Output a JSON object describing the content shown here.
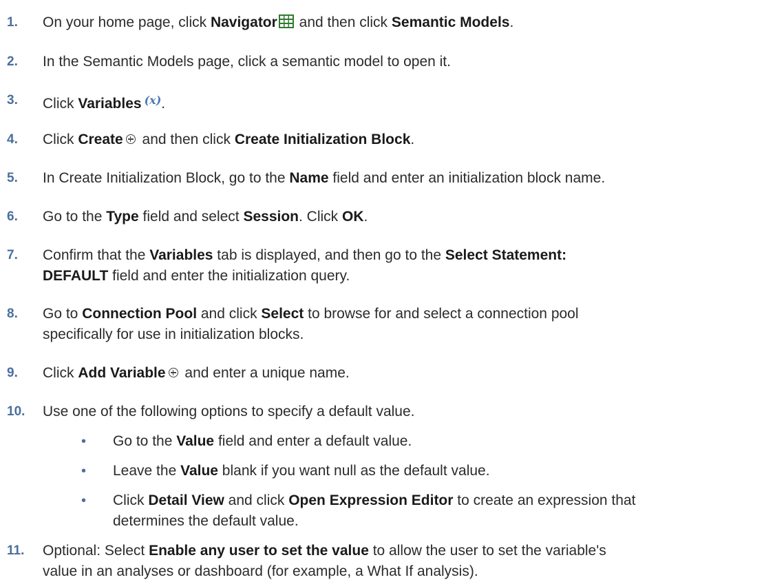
{
  "steps": [
    {
      "num": "1.",
      "parts": [
        "On your home page, click ",
        "Navigator",
        " and then click ",
        "Semantic Models",
        "."
      ]
    },
    {
      "num": "2.",
      "text": "In the Semantic Models page, click a semantic model to open it."
    },
    {
      "num": "3.",
      "parts": [
        "Click ",
        "Variables",
        "."
      ]
    },
    {
      "num": "4.",
      "parts": [
        "Click ",
        "Create",
        " and then click ",
        "Create Initialization Block",
        "."
      ]
    },
    {
      "num": "5.",
      "parts": [
        "In Create Initialization Block, go to the ",
        "Name",
        " field and enter an initialization block name."
      ]
    },
    {
      "num": "6.",
      "parts": [
        "Go to the ",
        "Type",
        " field and select ",
        "Session",
        ". Click ",
        "OK",
        "."
      ]
    },
    {
      "num": "7.",
      "parts": [
        "Confirm that the ",
        "Variables",
        " tab is displayed, and then go to the ",
        "Select Statement:",
        "DEFAULT",
        " field and enter the initialization query."
      ]
    },
    {
      "num": "8.",
      "parts": [
        "Go to ",
        "Connection Pool",
        " and click ",
        "Select",
        " to browse for and select a connection pool",
        "specifically for use in initialization blocks."
      ]
    },
    {
      "num": "9.",
      "parts": [
        "Click ",
        "Add Variable",
        " and enter a unique name."
      ]
    },
    {
      "num": "10.",
      "text": "Use one of the following options to specify a default value."
    },
    {
      "num": "11.",
      "parts": [
        "Optional: Select ",
        "Enable any user to set the value",
        " to allow the user to set the variable's",
        "value in an analyses or dashboard (for example, a What If analysis)."
      ]
    }
  ],
  "bullets": [
    {
      "parts": [
        "Go to the ",
        "Value",
        " field and enter a default value."
      ]
    },
    {
      "parts": [
        "Leave the ",
        "Value",
        " blank if you want null as the default value."
      ]
    },
    {
      "parts": [
        "Click ",
        "Detail View",
        " and click ",
        "Open Expression Editor",
        " to create an expression that",
        "determines the default value."
      ]
    }
  ],
  "icons": {
    "variables_glyph": "(x)",
    "bullet_glyph": "•"
  },
  "colors": {
    "step_number": "#4a6f9d",
    "navigator_icon": "#2f7a2f",
    "variables_icon": "#4b79b4"
  }
}
